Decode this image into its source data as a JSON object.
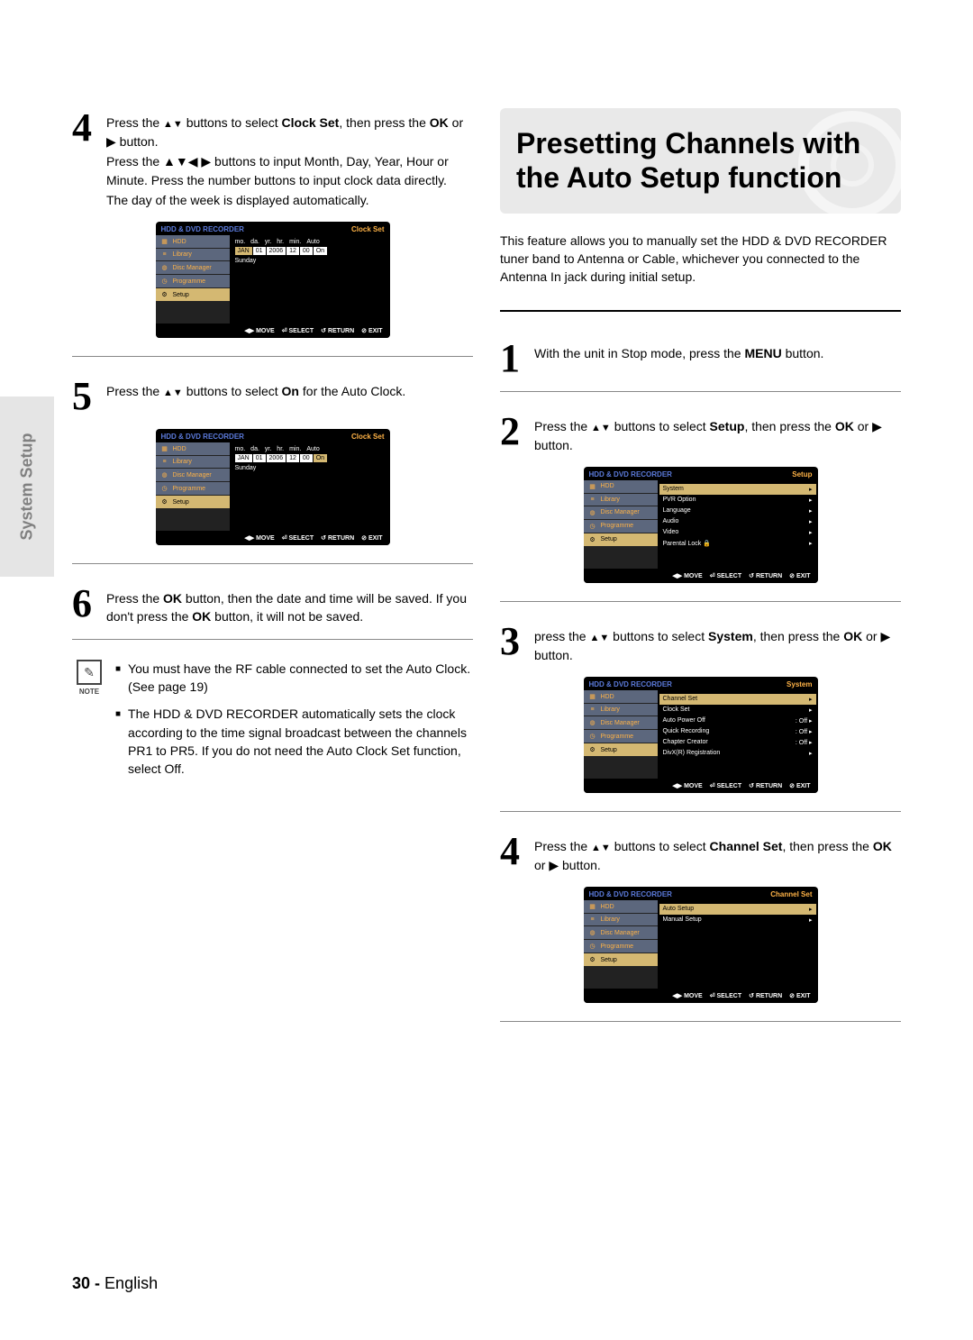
{
  "side_tab": "System Setup",
  "heading": "Presetting Channels with the Auto Setup function",
  "intro": "This feature allows you to manually set the HDD & DVD RECORDER tuner band to Antenna or Cable, whichever you connected to the Antenna In jack during initial setup.",
  "left": {
    "step4": {
      "l1a": "Press the ",
      "l1b": " buttons to select ",
      "l1c": ", then press the ",
      "l1d": " button.",
      "bold_clock": "Clock Set",
      "bold_ok": "OK",
      "play": " or ▶",
      "arrows_ud": "▲▼",
      "p2": "Press the ▲▼◀ ▶ buttons to input Month, Day, Year, Hour or Minute. Press the number buttons to input clock data directly.",
      "p3": "The day of the week is displayed automatically."
    },
    "step5": {
      "a": "Press the ",
      "arrows_ud": "▲▼",
      "b": " buttons to select ",
      "bold_on": "On",
      "c": " for the Auto Clock."
    },
    "step6": {
      "a": "Press the ",
      "bold_ok": "OK",
      "b": " button, then the date and time will be saved. If you don't press the ",
      "c": " button, it will not be saved."
    },
    "note": {
      "label": "NOTE",
      "n1": "You must have the RF cable connected to set the Auto Clock. (See page 19)",
      "n2": "The HDD & DVD RECORDER automatically sets the clock according to the time signal broadcast between the channels PR1 to PR5. If you do not need the Auto Clock Set function, select Off."
    }
  },
  "right": {
    "step1": {
      "a": "With the unit in Stop mode, press the ",
      "bold": "MENU",
      "b": " button."
    },
    "step2": {
      "a": "Press the ",
      "arrows": "▲▼",
      "b": " buttons to select ",
      "bold": "Setup",
      "c": ", then press the ",
      "ok": "OK",
      "d": " or ▶ button."
    },
    "step3": {
      "a": "press the ",
      "arrows": "▲▼",
      "b": " buttons to select ",
      "bold": "System",
      "c": ", then press the ",
      "ok": "OK",
      "d": " or ▶ button."
    },
    "step4": {
      "a": "Press the ",
      "arrows": "▲▼",
      "b": " buttons to select ",
      "bold": "Channel Set",
      "c": ", then press the ",
      "ok": "OK",
      "d": " or ▶ button."
    }
  },
  "osd": {
    "title_left": "HDD & DVD RECORDER",
    "clock_set": "Clock Set",
    "setup": "Setup",
    "system": "System",
    "channel_set": "Channel Set",
    "side": {
      "hdd": "HDD",
      "library": "Library",
      "disc_mgr": "Disc Manager",
      "programme": "Programme",
      "setup": "Setup"
    },
    "clock": {
      "hdr": [
        "mo.",
        "da.",
        "yr.",
        "hr.",
        "min.",
        "Auto"
      ],
      "vals": [
        "JAN",
        "01",
        "2006",
        "12",
        "00",
        "On"
      ],
      "day": "Sunday"
    },
    "setup_menu": [
      "System",
      "PVR Option",
      "Language",
      "Audio",
      "Video",
      "Parental Lock"
    ],
    "system_menu": [
      {
        "k": "Channel Set",
        "v": ""
      },
      {
        "k": "Clock Set",
        "v": ""
      },
      {
        "k": "Auto Power Off",
        "v": ": Off"
      },
      {
        "k": "Quick Recording",
        "v": ": Off"
      },
      {
        "k": "Chapter Creator",
        "v": ": Off"
      },
      {
        "k": "DivX(R) Registration",
        "v": ""
      }
    ],
    "channel_menu": [
      "Auto Setup",
      "Manual Setup"
    ],
    "foot": {
      "move": "MOVE",
      "select": "SELECT",
      "return": "RETURN",
      "exit": "EXIT"
    },
    "lock_icon": "🔒"
  },
  "page_footer": {
    "num": "30 -",
    "lang": "English"
  }
}
